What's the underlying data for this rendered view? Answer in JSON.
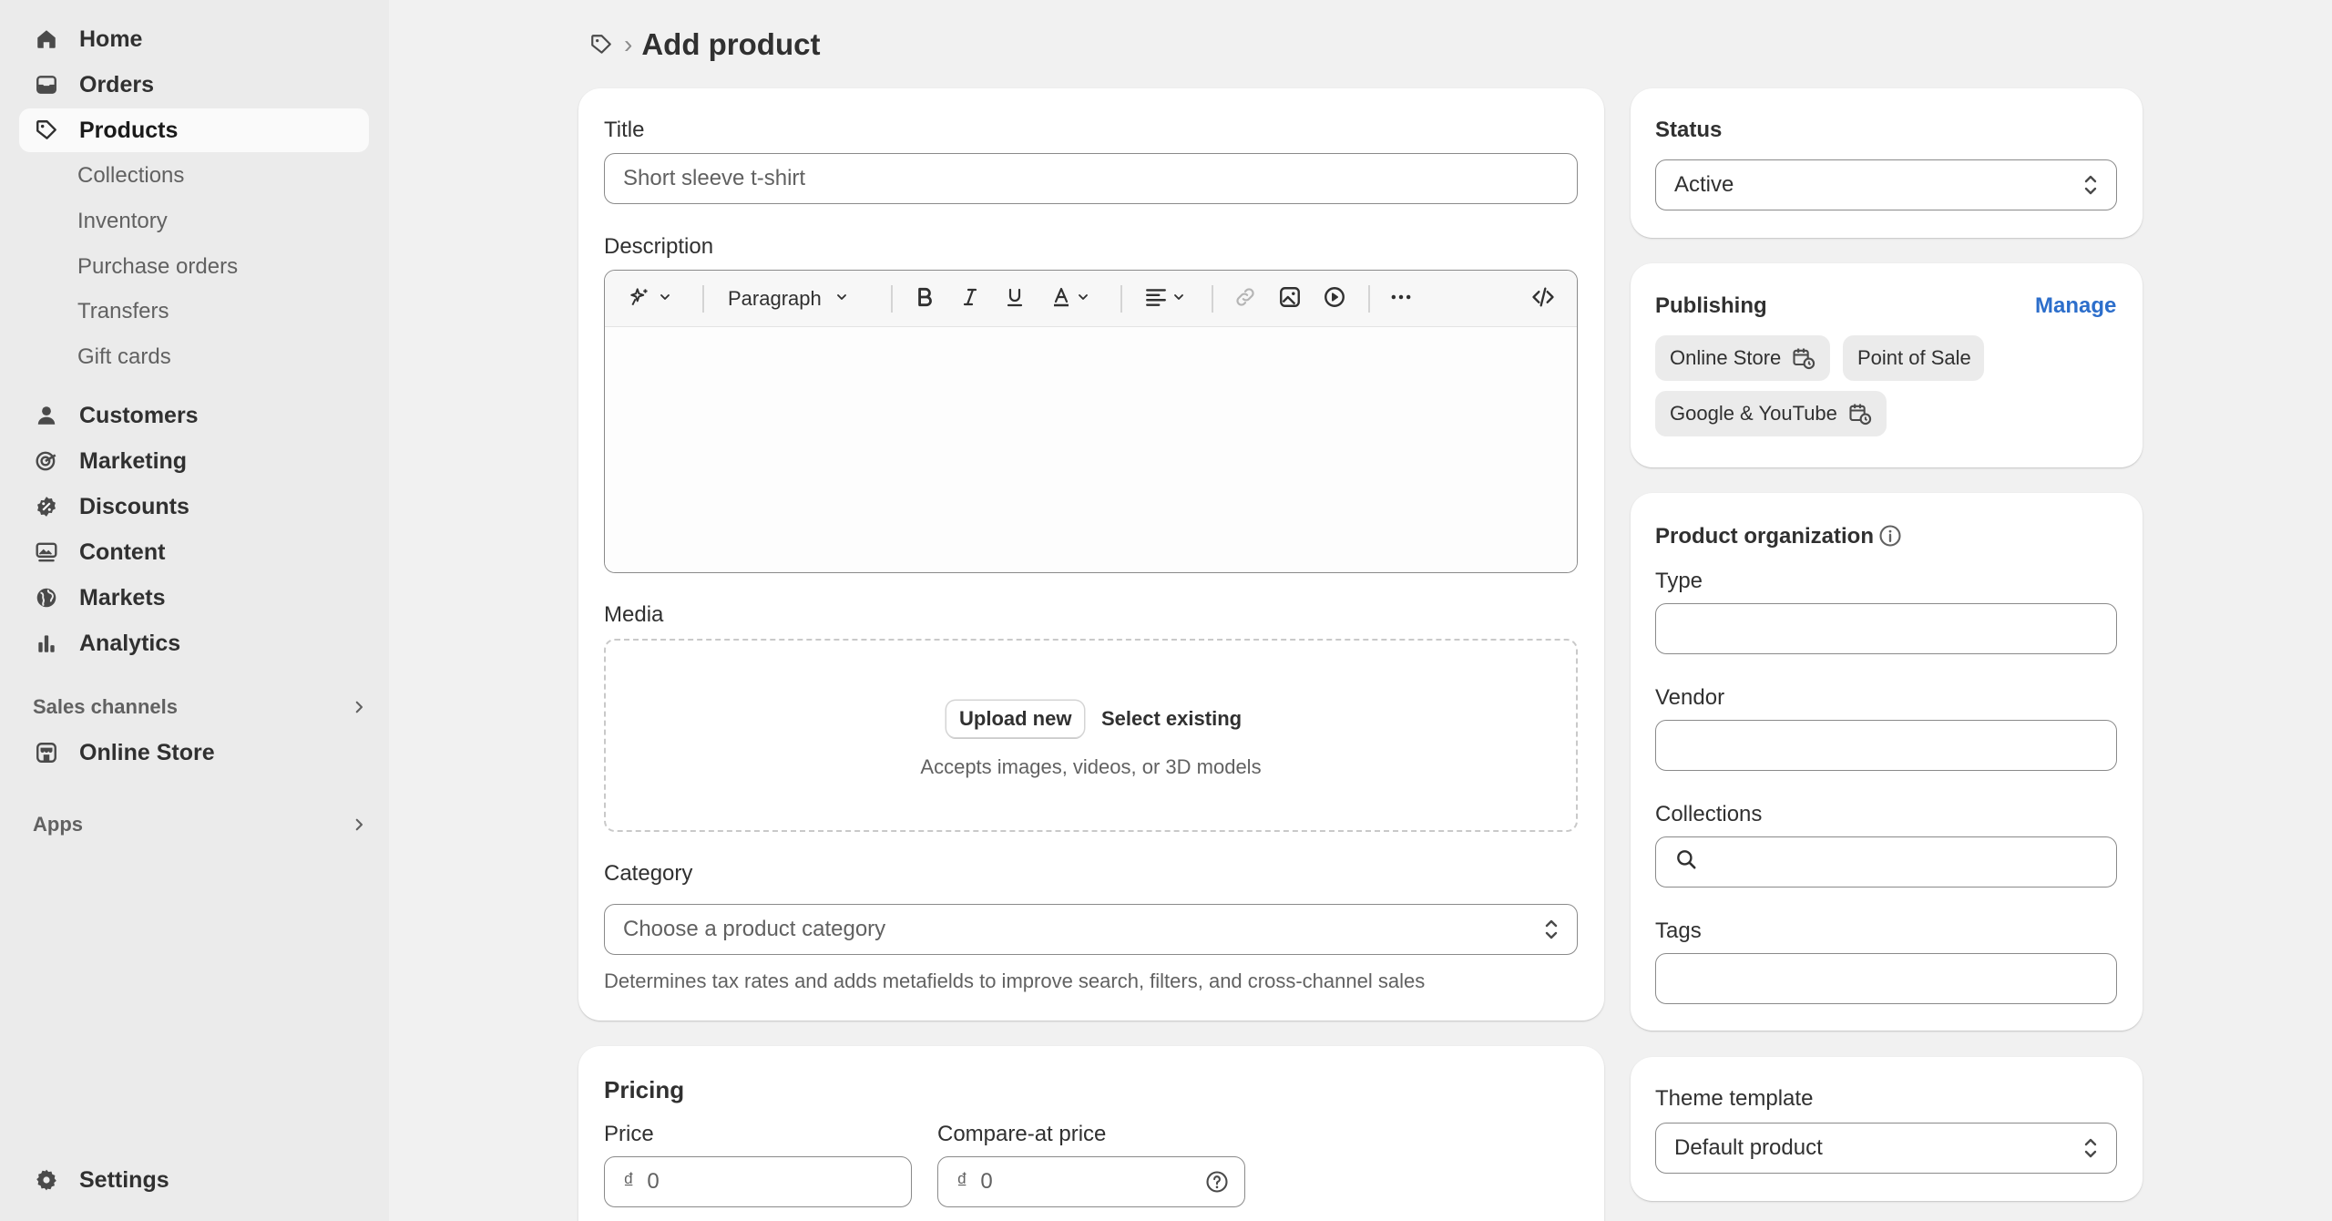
{
  "sidebar": {
    "items": [
      {
        "label": "Home",
        "icon": "home-icon"
      },
      {
        "label": "Orders",
        "icon": "inbox-icon"
      },
      {
        "label": "Products",
        "icon": "tag-icon"
      }
    ],
    "product_subitems": [
      "Collections",
      "Inventory",
      "Purchase orders",
      "Transfers",
      "Gift cards"
    ],
    "items2": [
      {
        "label": "Customers",
        "icon": "person-icon"
      },
      {
        "label": "Marketing",
        "icon": "target-icon"
      },
      {
        "label": "Discounts",
        "icon": "discount-icon"
      },
      {
        "label": "Content",
        "icon": "content-icon"
      },
      {
        "label": "Markets",
        "icon": "globe-icon"
      },
      {
        "label": "Analytics",
        "icon": "bar-chart-icon"
      }
    ],
    "sales_channels_label": "Sales channels",
    "online_store_label": "Online Store",
    "apps_label": "Apps",
    "settings_label": "Settings"
  },
  "header": {
    "breadcrumb_separator": "›",
    "page_title": "Add product"
  },
  "main_card": {
    "title_label": "Title",
    "title_placeholder": "Short sleeve t-shirt",
    "description_label": "Description",
    "paragraph_label": "Paragraph",
    "media_label": "Media",
    "upload_new": "Upload new",
    "select_existing": "Select existing",
    "media_hint": "Accepts images, videos, or 3D models",
    "category_label": "Category",
    "category_placeholder": "Choose a product category",
    "category_help": "Determines tax rates and adds metafields to improve search, filters, and cross-channel sales"
  },
  "pricing": {
    "heading": "Pricing",
    "price_label": "Price",
    "compare_label": "Compare-at price",
    "currency_symbol": "₫",
    "price_value": "0",
    "compare_value": "0"
  },
  "status": {
    "heading": "Status",
    "value": "Active"
  },
  "publishing": {
    "heading": "Publishing",
    "manage": "Manage",
    "channels": [
      "Online Store",
      "Point of Sale",
      "Google & YouTube"
    ]
  },
  "organization": {
    "heading": "Product organization",
    "type_label": "Type",
    "vendor_label": "Vendor",
    "collections_label": "Collections",
    "tags_label": "Tags"
  },
  "theme_template": {
    "label": "Theme template",
    "value": "Default product"
  }
}
